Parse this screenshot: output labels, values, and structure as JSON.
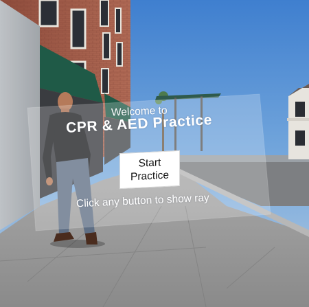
{
  "menu": {
    "welcome_text": "Welcome to",
    "app_title": "CPR & AED Practice",
    "start_button_line1": "Start",
    "start_button_line2": "Practice",
    "hint_text": "Click any button to show ray"
  },
  "colors": {
    "sky": "#5f97d6",
    "panel_overlay": "rgba(255,255,255,0.22)",
    "text": "#ffffff",
    "button_bg": "#ffffff",
    "button_text": "#111111"
  },
  "icons": {
    "player_avatar": "standing-man-figure"
  }
}
